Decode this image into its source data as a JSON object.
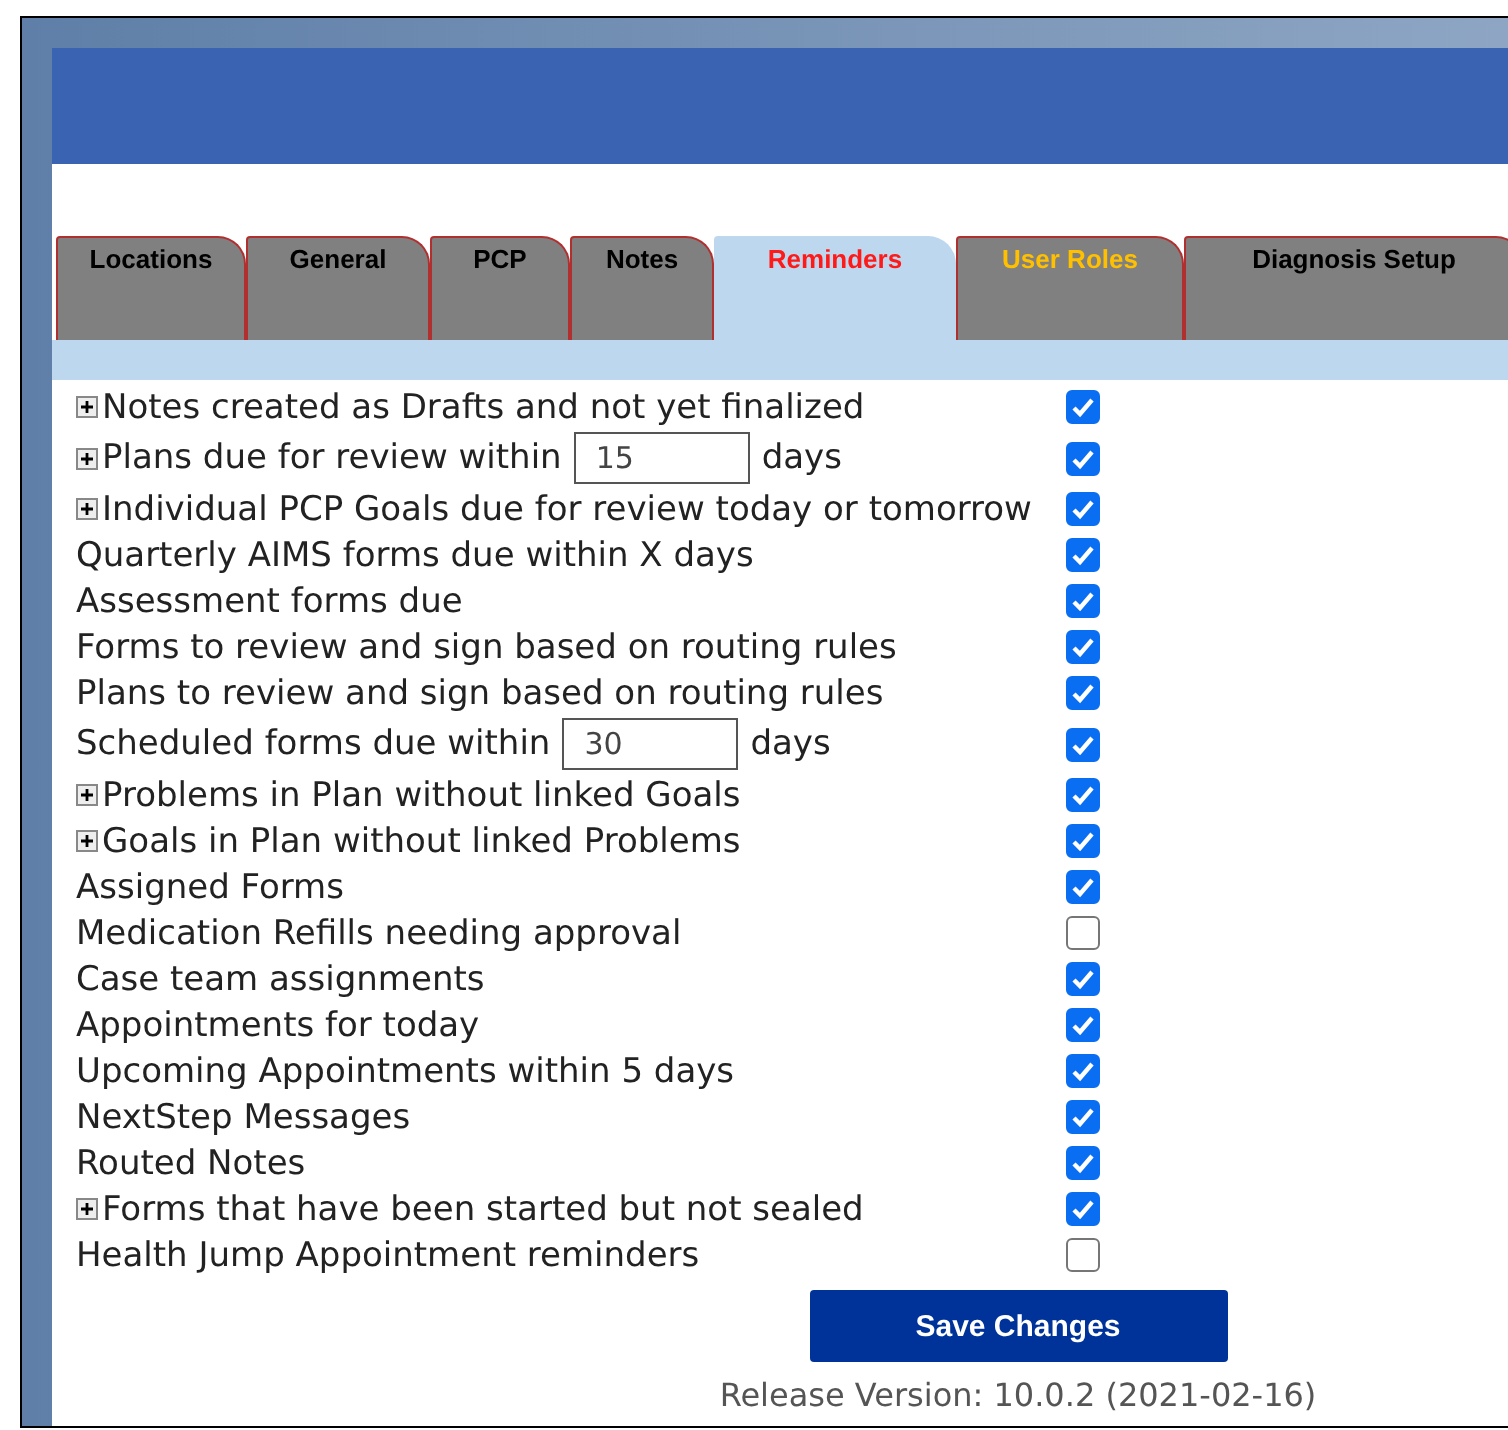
{
  "tabs": [
    {
      "label": "Locations",
      "selected": false,
      "color": "#000000"
    },
    {
      "label": "General",
      "selected": false,
      "color": "#000000"
    },
    {
      "label": "PCP",
      "selected": false,
      "color": "#000000"
    },
    {
      "label": "Notes",
      "selected": false,
      "color": "#000000"
    },
    {
      "label": "Reminders",
      "selected": true,
      "color": "#ff1a1a"
    },
    {
      "label": "User Roles",
      "selected": false,
      "color": "#ffc000"
    },
    {
      "label": "Diagnosis Setup",
      "selected": false,
      "color": "#000000"
    }
  ],
  "reminders": [
    {
      "kind": "plain",
      "expandable": true,
      "label": "Notes created as Drafts and not yet finalized",
      "checked": true
    },
    {
      "kind": "days",
      "expandable": true,
      "label": "Plans due for review within",
      "value": "15",
      "suffix": "days",
      "checked": true
    },
    {
      "kind": "plain",
      "expandable": true,
      "label": "Individual PCP Goals due for review today or tomorrow",
      "checked": true
    },
    {
      "kind": "plain",
      "expandable": false,
      "label": "Quarterly AIMS forms due within X days",
      "checked": true
    },
    {
      "kind": "plain",
      "expandable": false,
      "label": "Assessment forms due",
      "checked": true
    },
    {
      "kind": "plain",
      "expandable": false,
      "label": "Forms to review and sign based on routing rules",
      "checked": true
    },
    {
      "kind": "plain",
      "expandable": false,
      "label": "Plans to review and sign based on routing rules",
      "checked": true
    },
    {
      "kind": "days",
      "expandable": false,
      "label": "Scheduled forms due within",
      "value": "30",
      "suffix": "days",
      "checked": true
    },
    {
      "kind": "plain",
      "expandable": true,
      "label": "Problems in Plan without linked Goals",
      "checked": true
    },
    {
      "kind": "plain",
      "expandable": true,
      "label": "Goals in Plan without linked Problems",
      "checked": true
    },
    {
      "kind": "plain",
      "expandable": false,
      "label": "Assigned Forms",
      "checked": true
    },
    {
      "kind": "plain",
      "expandable": false,
      "label": "Medication Refills needing approval",
      "checked": false
    },
    {
      "kind": "plain",
      "expandable": false,
      "label": "Case team assignments",
      "checked": true
    },
    {
      "kind": "plain",
      "expandable": false,
      "label": "Appointments for today",
      "checked": true
    },
    {
      "kind": "plain",
      "expandable": false,
      "label": "Upcoming Appointments within 5 days",
      "checked": true
    },
    {
      "kind": "plain",
      "expandable": false,
      "label": "NextStep Messages",
      "checked": true
    },
    {
      "kind": "plain",
      "expandable": false,
      "label": "Routed Notes",
      "checked": true
    },
    {
      "kind": "plain",
      "expandable": true,
      "label": "Forms that have been started but not sealed",
      "checked": true
    },
    {
      "kind": "plain",
      "expandable": false,
      "label": "Health Jump Appointment reminders",
      "checked": false
    }
  ],
  "save_button": "Save Changes",
  "release_version": "Release Version: 10.0.2 (2021-02-16)"
}
